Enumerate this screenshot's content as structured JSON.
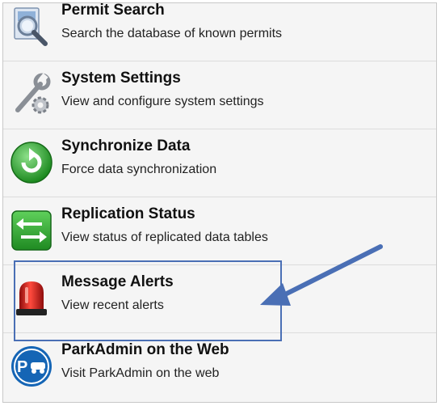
{
  "menu": {
    "items": [
      {
        "title": "Permit Search",
        "subtitle": "Search the database of known permits",
        "icon": "permit-search-icon"
      },
      {
        "title": "System Settings",
        "subtitle": "View and configure system settings",
        "icon": "wrench-gear-icon"
      },
      {
        "title": "Synchronize Data",
        "subtitle": "Force data synchronization",
        "icon": "sync-icon"
      },
      {
        "title": "Replication Status",
        "subtitle": "View status of replicated data tables",
        "icon": "replication-arrows-icon"
      },
      {
        "title": "Message Alerts",
        "subtitle": "View recent alerts",
        "icon": "alert-siren-icon"
      },
      {
        "title": "ParkAdmin on the Web",
        "subtitle": "Visit ParkAdmin on the web",
        "icon": "parkadmin-logo-icon"
      }
    ]
  },
  "annotation": {
    "highlighted_item": "Message Alerts",
    "highlight_color": "#4a6fb5"
  },
  "colors": {
    "background": "#f5f5f5",
    "divider": "#dcdcdc",
    "title": "#111111",
    "subtitle": "#222222"
  }
}
